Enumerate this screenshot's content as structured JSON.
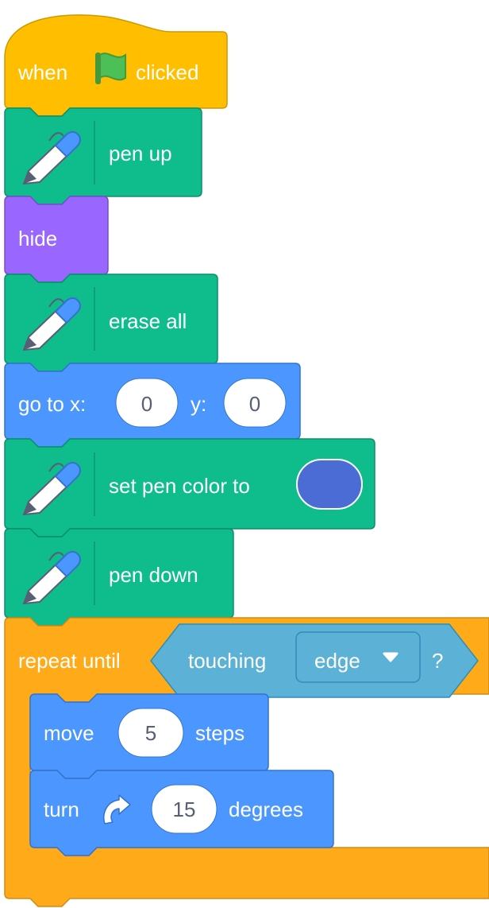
{
  "blocks": {
    "when_flag": {
      "when_label": "when",
      "clicked_label": "clicked"
    },
    "pen_up": {
      "label": "pen up"
    },
    "hide": {
      "label": "hide"
    },
    "erase_all": {
      "label": "erase all"
    },
    "go_to": {
      "label_x": "go to x:",
      "x_value": "0",
      "label_y": "y:",
      "y_value": "0"
    },
    "set_pen_color": {
      "label": "set pen color to",
      "color": "#4a6cd4"
    },
    "pen_down": {
      "label": "pen down"
    },
    "repeat_until": {
      "label": "repeat until",
      "touching_label": "touching",
      "target_value": "edge",
      "question_label": "?"
    },
    "move": {
      "label": "move",
      "value": "5",
      "steps_label": "steps"
    },
    "turn": {
      "label": "turn",
      "value": "15",
      "degrees_label": "degrees"
    }
  },
  "colors": {
    "events": "#ffbf00",
    "pen": "#0fbd8c",
    "looks": "#9966ff",
    "motion": "#4c97ff",
    "control": "#ffab19",
    "sensing": "#5cb1d6"
  },
  "icons": {
    "flag": "green-flag-icon",
    "pen": "pen-extension-icon",
    "rotate": "rotate-right-icon",
    "dropdown": "dropdown-caret-icon"
  }
}
